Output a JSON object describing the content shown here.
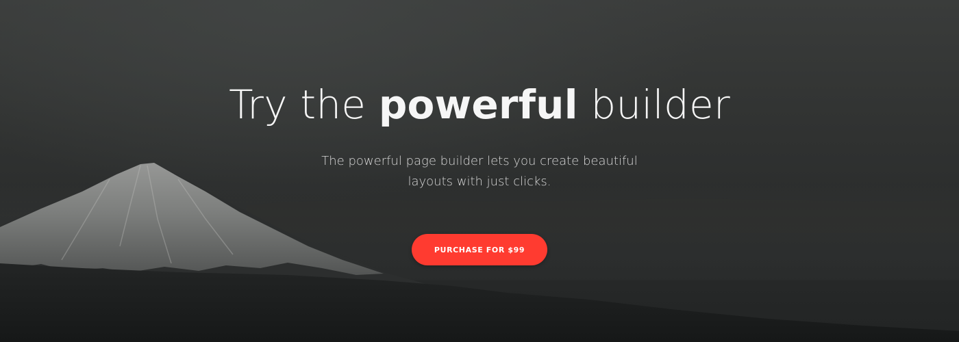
{
  "hero": {
    "headline_prefix": "Try the ",
    "headline_bold": "powerful",
    "headline_suffix": " builder",
    "subtitle": "The powerful page builder lets you create beautiful layouts with just clicks.",
    "cta_label": "PURCHASE FOR $99"
  },
  "colors": {
    "accent": "#ff3b30",
    "overlay": "#2b2d2d",
    "text": "#ffffff"
  }
}
